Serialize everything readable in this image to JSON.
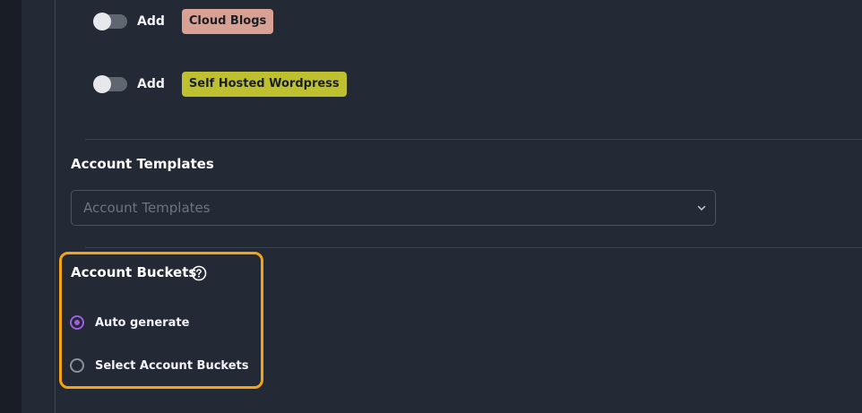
{
  "integrations": [
    {
      "toggle_label": "Add",
      "tag": "Cloud Blogs",
      "tag_color": "#d9a193",
      "enabled": false
    },
    {
      "toggle_label": "Add",
      "tag": "Self Hosted Wordpress",
      "tag_color": "#bfc02f",
      "enabled": false
    }
  ],
  "account_templates": {
    "title": "Account Templates",
    "placeholder": "Account Templates"
  },
  "account_buckets": {
    "title": "Account Buckets",
    "help_icon": "question-circle-icon",
    "options": [
      {
        "label": "Auto generate",
        "selected": true
      },
      {
        "label": "Select Account Buckets",
        "selected": false
      }
    ]
  },
  "colors": {
    "background": "#232a35",
    "accent_radio": "#a05de0",
    "highlight_border": "#f5a313"
  }
}
